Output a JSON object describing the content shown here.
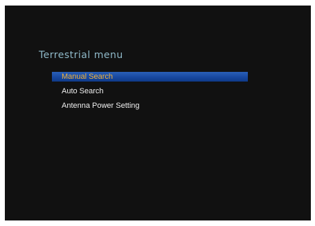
{
  "menu": {
    "title": "Terrestrial menu",
    "selected_index": 0,
    "items": [
      {
        "label": "Manual Search"
      },
      {
        "label": "Auto Search"
      },
      {
        "label": "Antenna Power Setting"
      }
    ]
  },
  "colors": {
    "background": "#111111",
    "title": "#8fb9c9",
    "item_text": "#f0f0f0",
    "selected_text": "#f2b33a",
    "selection_bar": "#1848a0"
  }
}
